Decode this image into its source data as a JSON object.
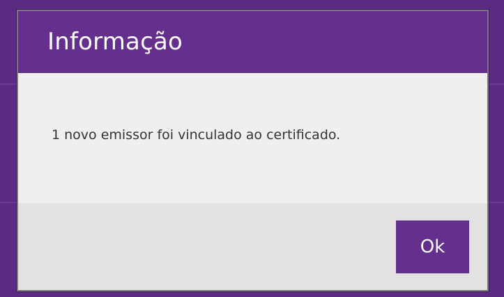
{
  "dialog": {
    "title": "Informação",
    "message": "1 novo emissor foi vinculado ao certificado.",
    "ok_label": "Ok"
  },
  "colors": {
    "header": "#652f8d",
    "overlay": "#5b2b84",
    "body": "#efefef",
    "footer": "#e2e2e2",
    "button": "#652f8d"
  }
}
